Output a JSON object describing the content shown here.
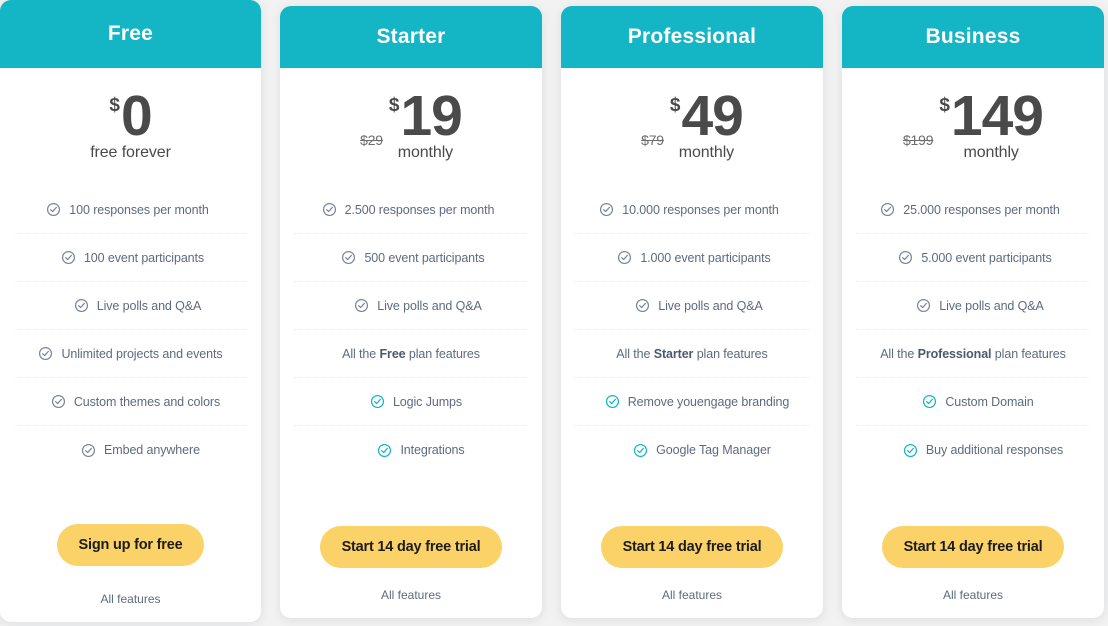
{
  "theme": {
    "header_teal": "#14b5c4",
    "cta_yellow": "#fbd267",
    "text_slate": "#5d6b7f",
    "price_gray": "#4a4a4a",
    "check_gray": "#7a8699",
    "check_teal": "#12b5c4"
  },
  "plans": [
    {
      "name": "Free",
      "currency": "$",
      "amount": "0",
      "old_price": "",
      "period": "free forever",
      "features": [
        {
          "label": "100 responses per month",
          "icon": "check-circle-icon",
          "icon_color": "gray",
          "has_icon": true,
          "align": "1"
        },
        {
          "label": "100 event participants",
          "icon": "check-circle-icon",
          "icon_color": "gray",
          "has_icon": true,
          "align": "2"
        },
        {
          "label": "Live polls and Q&A",
          "icon": "check-circle-icon",
          "icon_color": "gray",
          "has_icon": true,
          "align": "3"
        },
        {
          "label": "Unlimited projects and events",
          "icon": "check-circle-icon",
          "icon_color": "gray",
          "has_icon": true,
          "align": "4"
        },
        {
          "label": "Custom themes and colors",
          "icon": "check-circle-icon",
          "icon_color": "gray",
          "has_icon": true,
          "align": "5"
        },
        {
          "label": "Embed anywhere",
          "icon": "check-circle-icon",
          "icon_color": "gray",
          "has_icon": true,
          "align": "6"
        }
      ],
      "cta_label": "Sign up for free",
      "all_features_label": "All features"
    },
    {
      "name": "Starter",
      "currency": "$",
      "amount": "19",
      "old_price": "$29",
      "period": "monthly",
      "features": [
        {
          "label": "2.500 responses per month",
          "icon": "check-circle-icon",
          "icon_color": "gray",
          "has_icon": true,
          "align": "1"
        },
        {
          "label": "500 event participants",
          "icon": "check-circle-icon",
          "icon_color": "gray",
          "has_icon": true,
          "align": "2"
        },
        {
          "label": "Live polls and Q&A",
          "icon": "check-circle-icon",
          "icon_color": "gray",
          "has_icon": true,
          "align": "3"
        },
        {
          "label_prefix": "All the ",
          "label_bold": "Free",
          "label_suffix": " plan features",
          "has_icon": false,
          "align": "4"
        },
        {
          "label": "Logic Jumps",
          "icon": "check-circle-icon",
          "icon_color": "teal",
          "has_icon": true,
          "align": "5"
        },
        {
          "label": "Integrations",
          "icon": "check-circle-icon",
          "icon_color": "teal",
          "has_icon": true,
          "align": "6"
        }
      ],
      "cta_label": "Start 14 day free trial",
      "all_features_label": "All features"
    },
    {
      "name": "Professional",
      "currency": "$",
      "amount": "49",
      "old_price": "$79",
      "period": "monthly",
      "features": [
        {
          "label": "10.000 responses per month",
          "icon": "check-circle-icon",
          "icon_color": "gray",
          "has_icon": true,
          "align": "1"
        },
        {
          "label": "1.000 event participants",
          "icon": "check-circle-icon",
          "icon_color": "gray",
          "has_icon": true,
          "align": "2"
        },
        {
          "label": "Live polls and Q&A",
          "icon": "check-circle-icon",
          "icon_color": "gray",
          "has_icon": true,
          "align": "3"
        },
        {
          "label_prefix": "All the ",
          "label_bold": "Starter",
          "label_suffix": " plan features",
          "has_icon": false,
          "align": "4"
        },
        {
          "label": "Remove youengage branding",
          "icon": "check-circle-icon",
          "icon_color": "teal",
          "has_icon": true,
          "align": "5"
        },
        {
          "label": "Google Tag Manager",
          "icon": "check-circle-icon",
          "icon_color": "teal",
          "has_icon": true,
          "align": "6"
        }
      ],
      "cta_label": "Start 14 day free trial",
      "all_features_label": "All features"
    },
    {
      "name": "Business",
      "currency": "$",
      "amount": "149",
      "old_price": "$199",
      "period": "monthly",
      "features": [
        {
          "label": "25.000 responses per month",
          "icon": "check-circle-icon",
          "icon_color": "gray",
          "has_icon": true,
          "align": "1"
        },
        {
          "label": "5.000 event participants",
          "icon": "check-circle-icon",
          "icon_color": "gray",
          "has_icon": true,
          "align": "2"
        },
        {
          "label": "Live polls and Q&A",
          "icon": "check-circle-icon",
          "icon_color": "gray",
          "has_icon": true,
          "align": "3"
        },
        {
          "label_prefix": "All the ",
          "label_bold": "Professional",
          "label_suffix": " plan features",
          "has_icon": false,
          "align": "4"
        },
        {
          "label": "Custom Domain",
          "icon": "check-circle-icon",
          "icon_color": "teal",
          "has_icon": true,
          "align": "5"
        },
        {
          "label": "Buy additional responses",
          "icon": "check-circle-icon",
          "icon_color": "teal",
          "has_icon": true,
          "align": "6"
        }
      ],
      "cta_label": "Start 14 day free trial",
      "all_features_label": "All features"
    }
  ]
}
